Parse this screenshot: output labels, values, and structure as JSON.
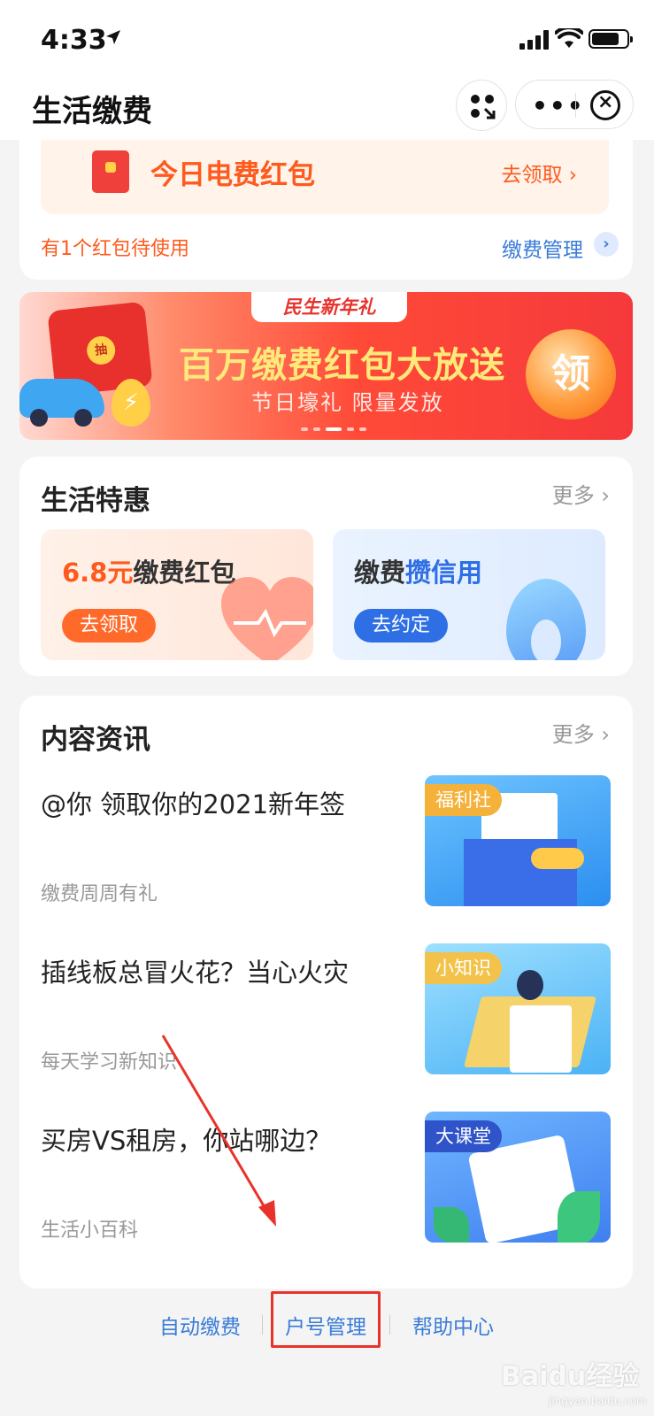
{
  "status_bar": {
    "time": "4:33"
  },
  "nav": {
    "title": "生活缴费",
    "more": "•••",
    "close": "×"
  },
  "electric": {
    "title": "今日电费红包",
    "link": "去领取",
    "link_arrow": "›",
    "note": "有1个红包待使用",
    "manage": "缴费管理",
    "manage_arrow": "›"
  },
  "banner": {
    "tag": "民生新年礼",
    "headline": "百万缴费红包大放送",
    "sub": "节日壕礼 限量发放",
    "button": "领",
    "redpack_text": "抽",
    "dots": 5,
    "active_dot": 2
  },
  "deals": {
    "title": "生活特惠",
    "more": "更多",
    "more_arrow": "›",
    "items": [
      {
        "amount": "6.8元",
        "title": "缴费红包",
        "button": "去领取"
      },
      {
        "prefix": "缴费",
        "highlight": "攒信用",
        "button": "去约定"
      }
    ]
  },
  "news": {
    "title": "内容资讯",
    "more": "更多",
    "more_arrow": "›",
    "items": [
      {
        "title": "@你 领取你的2021新年签",
        "source": "缴费周周有礼",
        "tag": "福利社"
      },
      {
        "title": "插线板总冒火花？当心火灾",
        "source": "每天学习新知识",
        "tag": "小知识"
      },
      {
        "title": "买房VS租房，你站哪边？",
        "source": "生活小百科",
        "tag": "大课堂"
      }
    ]
  },
  "footer": {
    "links": [
      "自动缴费",
      "户号管理",
      "帮助中心"
    ]
  },
  "watermark": {
    "text": "Baidu经验",
    "sub": "jingyan.baidu.com"
  },
  "colors": {
    "accent_orange": "#ff5a1e",
    "link_blue": "#3a7cd8",
    "annotation_red": "#e8332a"
  }
}
